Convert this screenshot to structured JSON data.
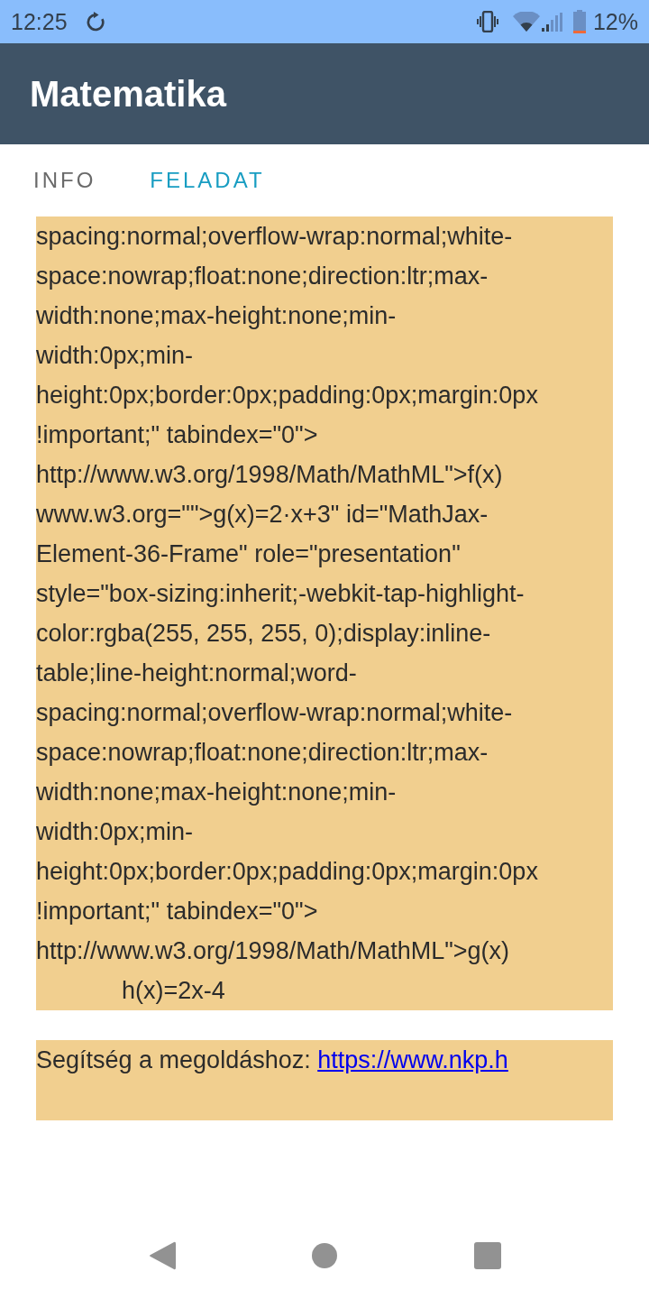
{
  "status_bar": {
    "time": "12:25",
    "battery_percent": "12%"
  },
  "app_bar": {
    "title": "Matematika"
  },
  "tabs": [
    {
      "label": "INFO",
      "selected": false
    },
    {
      "label": "FELADAT",
      "selected": true
    }
  ],
  "task_panel": {
    "lines": [
      {
        "kind": "code",
        "text": "spacing:normal;overflow-wrap:normal;white-"
      },
      {
        "kind": "code",
        "text": "space:nowrap;float:none;direction:ltr;max-"
      },
      {
        "kind": "code",
        "text": "width:none;max-height:none;min-"
      },
      {
        "kind": "code",
        "text": "width:0px;min-"
      },
      {
        "kind": "code",
        "text": "height:0px;border:0px;padding:0px;margin:0px"
      },
      {
        "kind": "code",
        "text": "!important;\" tabindex=\"0\">"
      },
      {
        "kind": "code",
        "text": "http://www.w3.org/1998/Math/MathML\">f(x)"
      },
      {
        "kind": "code",
        "text": "www.w3.org=\"\">g(x)=2·x+3\" id=\"MathJax-"
      },
      {
        "kind": "code",
        "text": "Element-36-Frame\" role=\"presentation\""
      },
      {
        "kind": "code",
        "text": "style=\"box-sizing:inherit;-webkit-tap-highlight-"
      },
      {
        "kind": "code",
        "text": "color:rgba(255, 255, 255, 0);display:inline-"
      },
      {
        "kind": "code",
        "text": "table;line-height:normal;word-"
      },
      {
        "kind": "code",
        "text": "spacing:normal;overflow-wrap:normal;white-"
      },
      {
        "kind": "code",
        "text": "space:nowrap;float:none;direction:ltr;max-"
      },
      {
        "kind": "code",
        "text": "width:none;max-height:none;min-"
      },
      {
        "kind": "code",
        "text": "width:0px;min-"
      },
      {
        "kind": "code",
        "text": "height:0px;border:0px;padding:0px;margin:0px"
      },
      {
        "kind": "code",
        "text": "!important;\" tabindex=\"0\">"
      },
      {
        "kind": "code",
        "text": "http://www.w3.org/1998/Math/MathML\">g(x)"
      },
      {
        "kind": "formula",
        "text": "h(x)=2x-4"
      }
    ]
  },
  "help_panel": {
    "label": "Segítség a megoldáshoz:",
    "link": "https://www.nkp.h"
  }
}
